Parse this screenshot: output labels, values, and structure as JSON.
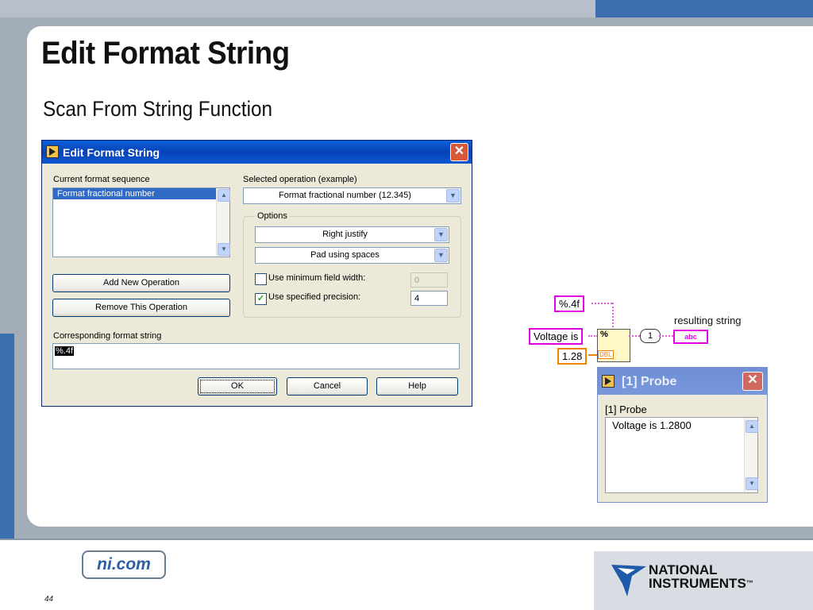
{
  "slide": {
    "title": "Edit Format String",
    "subtitle": "Scan From String Function",
    "page_number": "44",
    "website": "ni.com",
    "logo_line1": "NATIONAL",
    "logo_line2": "INSTRUMENTS",
    "logo_tm": "™"
  },
  "dialog": {
    "title": "Edit Format String",
    "current_format_sequence_label": "Current format sequence",
    "sequence_items": [
      "Format fractional number"
    ],
    "selected_operation_label": "Selected operation (example)",
    "selected_operation_value": "Format fractional number (12.345)",
    "options_label": "Options",
    "justify_value": "Right justify",
    "pad_value": "Pad using spaces",
    "min_field_width_label": "Use minimum field width:",
    "min_field_width_value": "0",
    "min_field_width_checked": false,
    "precision_label": "Use specified precision:",
    "precision_value": "4",
    "precision_checked": true,
    "add_button": "Add New Operation",
    "remove_button": "Remove This Operation",
    "format_string_label": "Corresponding format string",
    "format_string_value": "%.4f",
    "ok_button": "OK",
    "cancel_button": "Cancel",
    "help_button": "Help"
  },
  "diagram": {
    "format_constant": "%.4f",
    "string_constant": "Voltage is",
    "number_constant": "1.28",
    "index_constant": "1",
    "result_label": "resulting string",
    "node_glyph": "%",
    "dbl_tag": "DBL",
    "indicator_glyph": "abc"
  },
  "probe": {
    "title": "[1] Probe",
    "label": "[1] Probe",
    "value": "Voltage is 1.2800"
  },
  "colors": {
    "accent_blue": "#3b6fb0",
    "string_wire": "#e000e0",
    "numeric_wire": "#f08000",
    "xp_title": "#0842b6"
  }
}
